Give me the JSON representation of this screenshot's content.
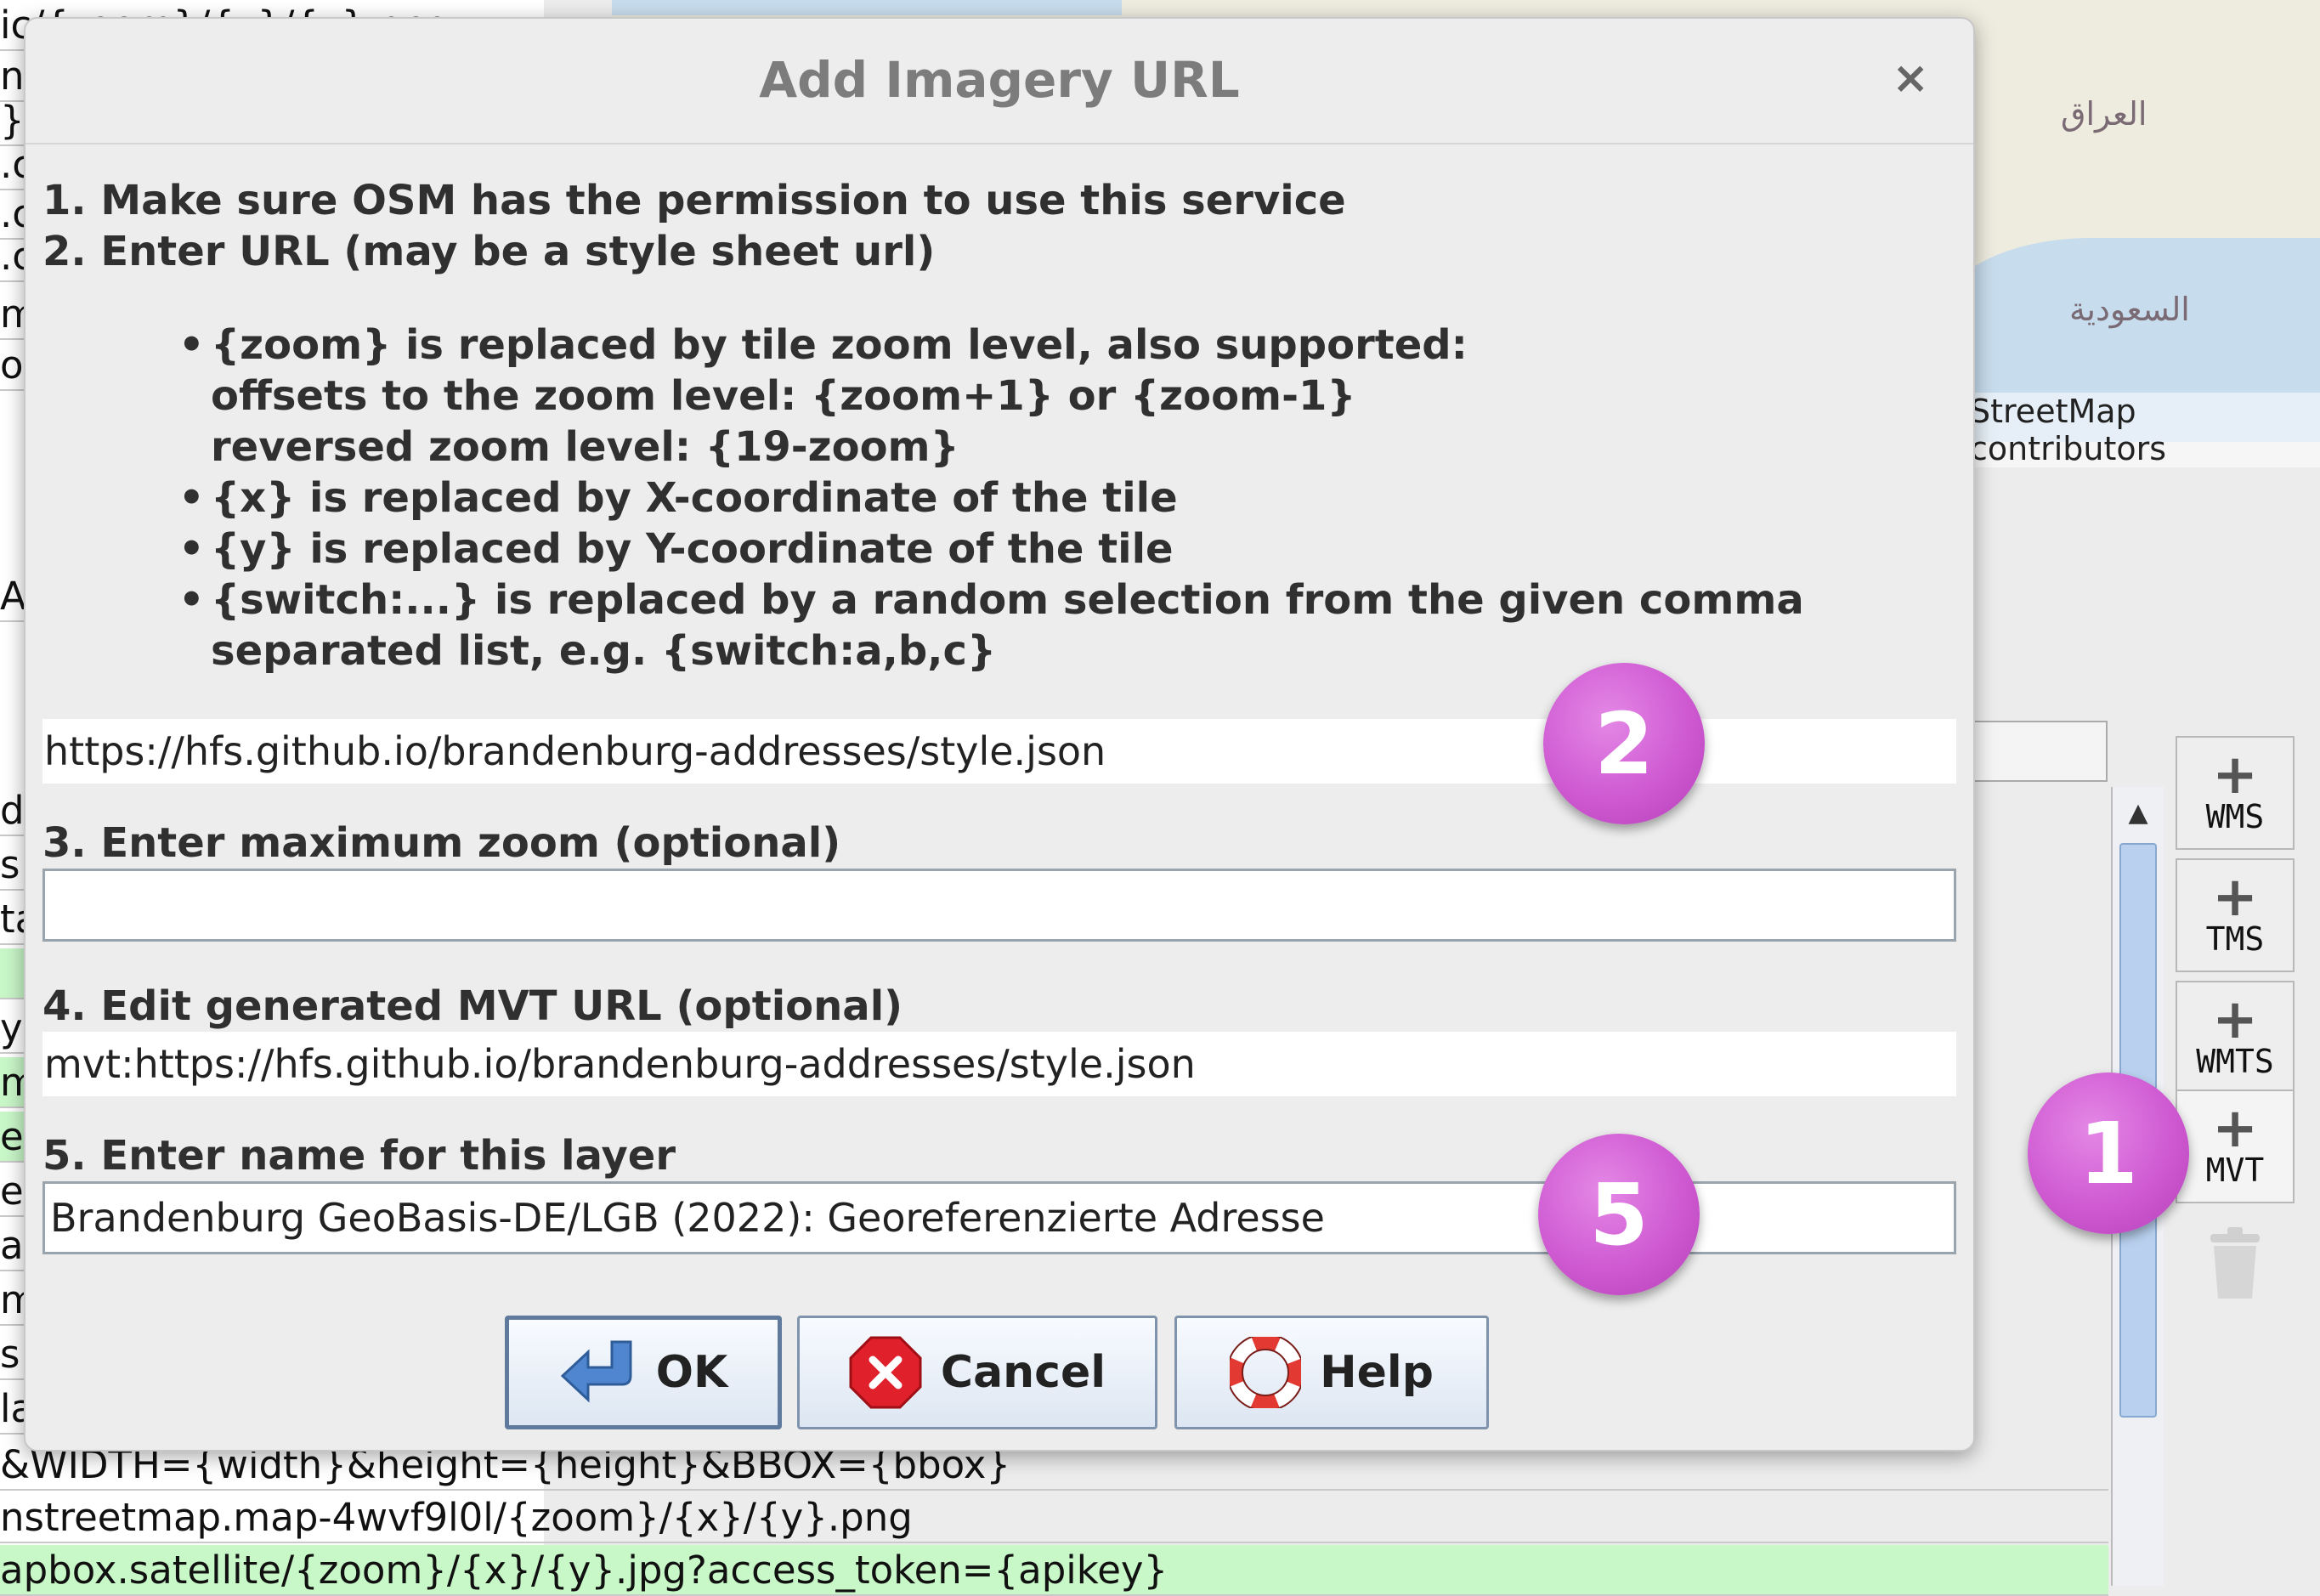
{
  "background": {
    "left_rows": [
      {
        "text": "ic/{zoom}/{x}/{y}.png",
        "green": false
      },
      {
        "text": "n/",
        "green": false
      },
      {
        "text": "}}",
        "green": false
      },
      {
        "text": ".c",
        "green": false
      },
      {
        "text": ".c",
        "green": false
      },
      {
        "text": ".c",
        "green": false
      },
      {
        "text": "m",
        "green": false
      },
      {
        "text": "or",
        "green": false
      },
      {
        "text": "Ac",
        "green": false
      },
      {
        "text": "dr",
        "green": false
      },
      {
        "text": "s",
        "green": false
      },
      {
        "text": "ta",
        "green": false
      },
      {
        "text": "",
        "green": true
      },
      {
        "text": "yle",
        "green": false
      },
      {
        "text": "m",
        "green": true
      },
      {
        "text": "er",
        "green": true
      },
      {
        "text": "er",
        "green": false
      },
      {
        "text": "ag",
        "green": false
      },
      {
        "text": "m",
        "green": false
      },
      {
        "text": "s",
        "green": false
      },
      {
        "text": "la",
        "green": false
      }
    ],
    "bottom_rows": [
      {
        "text": "&WIDTH={width}&height={height}&BBOX={bbox}",
        "green": false
      },
      {
        "text": "nstreetmap.map-4wvf9l0l/{zoom}/{x}/{y}.png",
        "green": false
      },
      {
        "text": "apbox.satellite/{zoom}/{x}/{y}.jpg?access_token={apikey}",
        "green": true
      }
    ],
    "map_labels": {
      "iraq": "العراق",
      "saudi": "السعودية",
      "attribution": "StreetMap contributors"
    },
    "side_buttons": [
      {
        "label": "WMS"
      },
      {
        "label": "TMS"
      },
      {
        "label": "WMTS"
      },
      {
        "label": "MVT"
      }
    ],
    "scroll_up": "▲"
  },
  "dialog": {
    "title": "Add Imagery URL",
    "close": "×",
    "step1": "1. Make sure OSM has the permission to use this service",
    "step2": "2. Enter URL (may be a style sheet url)",
    "bullets": {
      "b1": "{zoom} is replaced by tile zoom level, also supported:",
      "b1_line2": "offsets to the zoom level: {zoom+1} or {zoom-1}",
      "b1_line3": "reversed zoom level: {19-zoom}",
      "b2": "{x} is replaced by X-coordinate of the tile",
      "b3": "{y} is replaced by Y-coordinate of the tile",
      "b4": "{switch:...} is replaced by a random selection from the given comma",
      "b4_line2": "separated list, e.g. {switch:a,b,c}"
    },
    "url_value": "https://hfs.github.io/brandenburg-addresses/style.json",
    "step3": "3. Enter maximum zoom (optional)",
    "max_zoom_value": "",
    "step4": "4. Edit generated MVT URL (optional)",
    "mvt_url_value": "mvt:https://hfs.github.io/brandenburg-addresses/style.json",
    "step5": "5. Enter name for this layer",
    "layer_name_value": "Brandenburg GeoBasis-DE/LGB (2022): Georeferenzierte Adresse",
    "buttons": {
      "ok": "OK",
      "cancel": "Cancel",
      "help": "Help"
    }
  },
  "callouts": {
    "c1": "1",
    "c2": "2",
    "c5": "5"
  },
  "colors": {
    "callout": "#cf5ad2",
    "green_row": "#c8f7c8",
    "map_water": "#c7dced"
  }
}
